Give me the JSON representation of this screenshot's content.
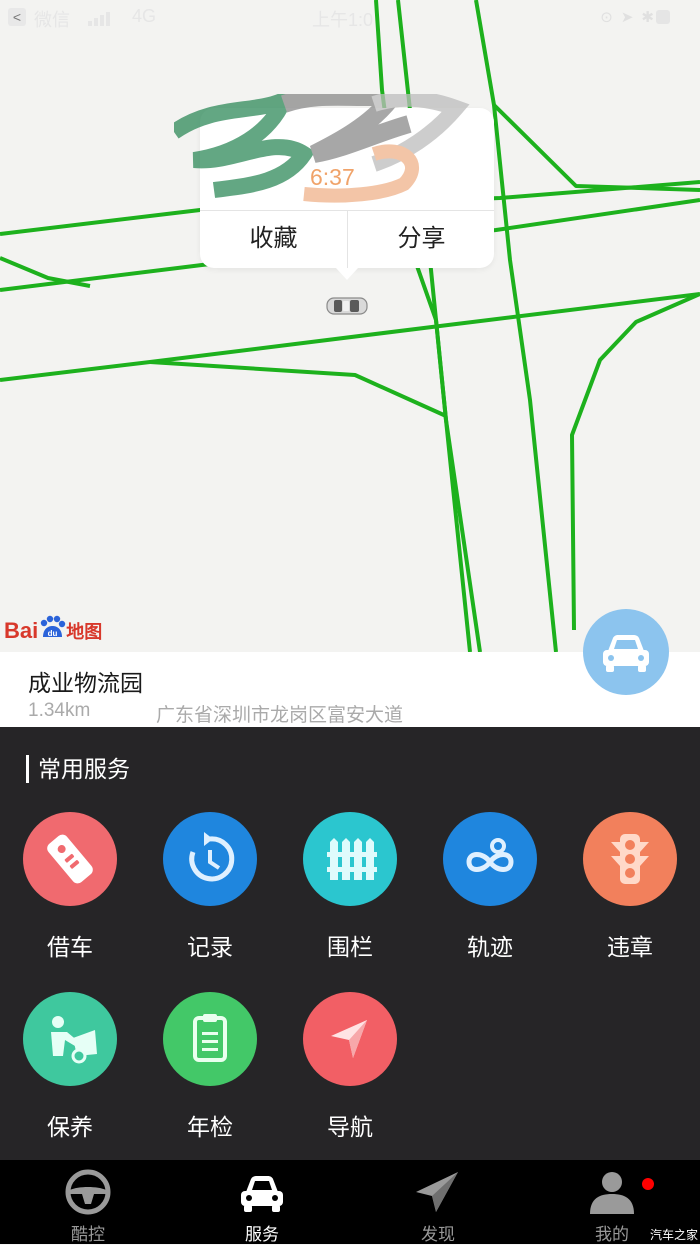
{
  "status_bar": {
    "back_glyph": "<",
    "carrier": "微信",
    "network": "4G",
    "time": "上午1:0",
    "icons": [
      "rotation-lock-icon",
      "location-icon",
      "bluetooth-icon",
      "battery-icon"
    ]
  },
  "map": {
    "road_color": "#1db11d",
    "popup": {
      "time_fragment": "6:37",
      "collect_label": "收藏",
      "share_label": "分享"
    },
    "provider_logo": {
      "text_bai": "Bai",
      "text_du": "du",
      "text_map": "地图",
      "color": "#d8382b"
    },
    "locate_button_icon": "car-front-icon"
  },
  "location": {
    "name": "成业物流园",
    "distance": "1.34km",
    "address": "广东省深圳市龙岗区富安大道"
  },
  "services": {
    "title": "常用服务",
    "items": [
      {
        "label": "借车",
        "icon": "car-key-icon",
        "color": "#f06a6f"
      },
      {
        "label": "记录",
        "icon": "history-icon",
        "color": "#1f86de"
      },
      {
        "label": "围栏",
        "icon": "fence-icon",
        "color": "#2bc6cf"
      },
      {
        "label": "轨迹",
        "icon": "track-icon",
        "color": "#1f86de"
      },
      {
        "label": "违章",
        "icon": "traffic-light-icon",
        "color": "#f2805c"
      },
      {
        "label": "保养",
        "icon": "car-repair-icon",
        "color": "#3fc89e"
      },
      {
        "label": "年检",
        "icon": "clipboard-icon",
        "color": "#43c868"
      },
      {
        "label": "导航",
        "icon": "navigation-arrow-icon",
        "color": "#f25f65"
      }
    ]
  },
  "tabbar": {
    "tabs": [
      {
        "label": "酷控",
        "icon": "steering-wheel-icon",
        "active": false
      },
      {
        "label": "服务",
        "icon": "car-icon",
        "active": true
      },
      {
        "label": "发现",
        "icon": "paper-plane-icon",
        "active": false
      },
      {
        "label": "我的",
        "icon": "user-icon",
        "active": false
      }
    ],
    "notification_color": "#ff0000"
  },
  "watermark": "汽车之家"
}
